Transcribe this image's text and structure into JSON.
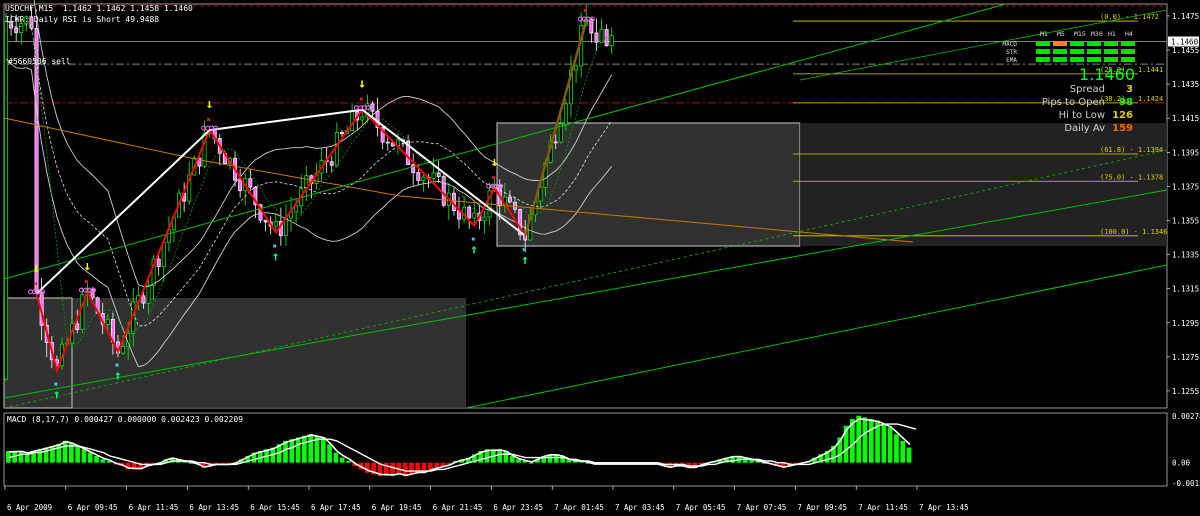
{
  "header": {
    "line1": "USDCHF,M15  1.1462 1.1462 1.1458 1.1460",
    "line2": "ICWR: Daily RSI is Short 49.9488"
  },
  "order_label": "#5660506 sell",
  "colors": {
    "background": "#000000",
    "bull": "#00ff00",
    "bear": "#ffffff",
    "accent_pink": "#ff66ff",
    "zigzag_red": "#ff0000",
    "zigzag_white": "#ffffff",
    "channel_green": "#00c000",
    "fib_yellow": "#e0d000",
    "ma_orange": "#cc7a00",
    "histogram_green": "#00ff00",
    "histogram_red": "#ff0000"
  },
  "chart_data": [
    {
      "type": "candlestick",
      "symbol": "USDCHF",
      "timeframe": "M15",
      "ylim": [
        1.1245,
        1.1482
      ],
      "y_ticks": [
        "1.1475",
        "1.1455",
        "1.1435",
        "1.1415",
        "1.1395",
        "1.1375",
        "1.1355",
        "1.1335",
        "1.1315",
        "1.1295",
        "1.1275",
        "1.1255"
      ],
      "current_price_label": "1.1460",
      "x_ticks": [
        "6 Apr 2009",
        "6 Apr 09:45",
        "6 Apr 11:45",
        "6 Apr 13:45",
        "6 Apr 15:45",
        "6 Apr 17:45",
        "6 Apr 19:45",
        "6 Apr 21:45",
        "6 Apr 23:45",
        "7 Apr 01:45",
        "7 Apr 03:45",
        "7 Apr 05:45",
        "7 Apr 07:45",
        "7 Apr 09:45",
        "7 Apr 11:45",
        "7 Apr 13:45"
      ],
      "zigzag_points": [
        {
          "time": "6 Apr 09:15",
          "price": 1.1312
        },
        {
          "time": "6 Apr 10:15",
          "price": 1.1267
        },
        {
          "time": "6 Apr 11:45",
          "price": 1.1313
        },
        {
          "time": "6 Apr 13:15",
          "price": 1.1278
        },
        {
          "time": "6 Apr 17:45",
          "price": 1.1408
        },
        {
          "time": "6 Apr 21:00",
          "price": 1.1348
        },
        {
          "time": "7 Apr 01:15",
          "price": 1.142
        },
        {
          "time": "7 Apr 06:45",
          "price": 1.1352
        },
        {
          "time": "7 Apr 07:45",
          "price": 1.1374
        },
        {
          "time": "7 Apr 09:15",
          "price": 1.1346
        },
        {
          "time": "7 Apr 12:15",
          "price": 1.1472
        }
      ],
      "fib_levels": [
        {
          "label": "(0.0) - 1.1472",
          "price": 1.1472
        },
        {
          "label": "(25.0) - 1.1441",
          "price": 1.1441
        },
        {
          "label": "(38.2) - 1.1424",
          "price": 1.1424
        },
        {
          "label": "(61.8) - 1.1394",
          "price": 1.1394
        },
        {
          "label": "(75.0) - 1.1378",
          "price": 1.1378
        },
        {
          "label": "(100.0) - 1.1346",
          "price": 1.1346
        }
      ],
      "info_panel": {
        "big_price": "1.1460",
        "rows": [
          {
            "label": "Spread",
            "value": "3",
            "color": "#e0d000"
          },
          {
            "label": "Pips to Open",
            "value": "98",
            "color": "#00ff00"
          },
          {
            "label": "Hi to Low",
            "value": "126",
            "color": "#e0d000"
          },
          {
            "label": "Daily Av",
            "value": "159",
            "color": "#ff6600"
          }
        ]
      },
      "signal_grid": {
        "columns": [
          "M1",
          "M5",
          "M15",
          "M30",
          "H1",
          "H4"
        ],
        "rows": [
          {
            "name": "MACD",
            "states": [
              "green",
              "orange",
              "green",
              "green",
              "green",
              "green"
            ]
          },
          {
            "name": "STR",
            "states": [
              "green",
              "green",
              "green",
              "green",
              "green",
              "green"
            ]
          },
          {
            "name": "EMA",
            "states": [
              "green",
              "green",
              "green",
              "green",
              "green",
              "green"
            ]
          }
        ]
      }
    },
    {
      "type": "bar",
      "name": "MACD",
      "title": "MACD (8,17,7) 0.000427 0.000000 0.002423 0.002209",
      "ylim": [
        -0.00121,
        0.00278
      ],
      "y_ticks": [
        "0.002789",
        "0.00",
        "-0.00121"
      ],
      "histogram": [
        0.0007,
        0.0007,
        0.0007,
        0.0006,
        0.0007,
        0.0008,
        0.0009,
        0.001,
        0.0011,
        0.0013,
        0.0012,
        0.001,
        0.0008,
        0.0006,
        0.0004,
        0.0002,
        0.0001,
        -0.0001,
        -0.0002,
        -0.0004,
        -0.0004,
        -0.0004,
        -0.0002,
        -0.0001,
        0.0,
        0.0002,
        0.0003,
        0.0002,
        0.0001,
        0.0,
        -0.0001,
        -0.0003,
        -0.0002,
        -0.0001,
        -0.0001,
        -0.0001,
        0.0,
        0.0002,
        0.0004,
        0.0006,
        0.0007,
        0.0008,
        0.0009,
        0.0011,
        0.0013,
        0.0014,
        0.0015,
        0.0016,
        0.0017,
        0.0016,
        0.0015,
        0.0011,
        0.0006,
        0.0003,
        0.0001,
        -0.0002,
        -0.0004,
        -0.0006,
        -0.0007,
        -0.0008,
        -0.0008,
        -0.0008,
        -0.0007,
        -0.0008,
        -0.0007,
        -0.0006,
        -0.0006,
        -0.0004,
        -0.0003,
        -0.0002,
        -0.0001,
        0.0001,
        0.0002,
        0.0003,
        0.0005,
        0.0007,
        0.0008,
        0.0008,
        0.0008,
        0.0007,
        0.0004,
        0.0002,
        0.0001,
        0.0,
        0.0002,
        0.0004,
        0.0005,
        0.0005,
        0.0004,
        0.0002,
        0.0001,
        0.0001,
        0.0,
        -0.0001,
        -0.0001,
        -0.0001,
        -0.0001,
        -0.0001,
        -0.0001,
        -0.0001,
        -0.0001,
        -0.0001,
        -0.0001,
        -0.0001,
        -0.0002,
        -0.0003,
        -0.0002,
        -0.0002,
        -0.0003,
        -0.0003,
        -0.0001,
        0.0,
        0.0001,
        0.0002,
        0.0003,
        0.0004,
        0.0004,
        0.0003,
        0.0002,
        0.0001,
        0.0,
        -0.0001,
        -0.0002,
        -0.0003,
        -0.0002,
        -0.0001,
        0.0,
        0.0001,
        0.0003,
        0.0005,
        0.0007,
        0.001,
        0.0015,
        0.0022,
        0.0026,
        0.0028,
        0.0027,
        0.0026,
        0.0025,
        0.0023,
        0.0021,
        0.0017,
        0.0013,
        0.0009
      ],
      "signal_line": [
        0.0003,
        0.0004,
        0.0005,
        0.0005,
        0.0006,
        0.0006,
        0.0007,
        0.0008,
        0.0009,
        0.001,
        0.001,
        0.001,
        0.0009,
        0.0008,
        0.0007,
        0.0006,
        0.0004,
        0.0003,
        0.0002,
        0.0001,
        0.0,
        -0.0001,
        -0.0001,
        -0.0001,
        -0.0001,
        0.0,
        0.0001,
        0.0001,
        0.0001,
        0.0001,
        0.0,
        0.0,
        -0.0001,
        -0.0001,
        -0.0001,
        -0.0001,
        -0.0001,
        0.0,
        0.0001,
        0.0002,
        0.0003,
        0.0004,
        0.0005,
        0.0006,
        0.0008,
        0.0009,
        0.0011,
        0.0012,
        0.0013,
        0.0014,
        0.0014,
        0.0014,
        0.0013,
        0.0011,
        0.0009,
        0.0007,
        0.0005,
        0.0003,
        0.0001,
        -0.0001,
        -0.0002,
        -0.0003,
        -0.0004,
        -0.0005,
        -0.0005,
        -0.0005,
        -0.0005,
        -0.0005,
        -0.0004,
        -0.0004,
        -0.0003,
        -0.0002,
        -0.0001,
        0.0,
        0.0001,
        0.0002,
        0.0003,
        0.0004,
        0.0005,
        0.0005,
        0.0005,
        0.0004,
        0.0003,
        0.0003,
        0.0003,
        0.0003,
        0.0003,
        0.0003,
        0.0003,
        0.0002,
        0.0002,
        0.0001,
        0.0001,
        0.0,
        0.0,
        0.0,
        0.0,
        0.0,
        0.0,
        0.0,
        0.0,
        0.0,
        0.0,
        0.0,
        -0.0001,
        -0.0001,
        -0.0001,
        -0.0001,
        -0.0002,
        -0.0002,
        -0.0002,
        -0.0001,
        -0.0001,
        0.0,
        0.0001,
        0.0001,
        0.0002,
        0.0002,
        0.0002,
        0.0002,
        0.0001,
        0.0001,
        0.0,
        0.0,
        -0.0001,
        -0.0001,
        -0.0001,
        -0.0001,
        0.0,
        0.0001,
        0.0002,
        0.0003,
        0.0005,
        0.0008,
        0.0011,
        0.0015,
        0.0018,
        0.002,
        0.0022,
        0.0023,
        0.0023,
        0.0023,
        0.0022,
        0.0021,
        0.002
      ]
    }
  ]
}
